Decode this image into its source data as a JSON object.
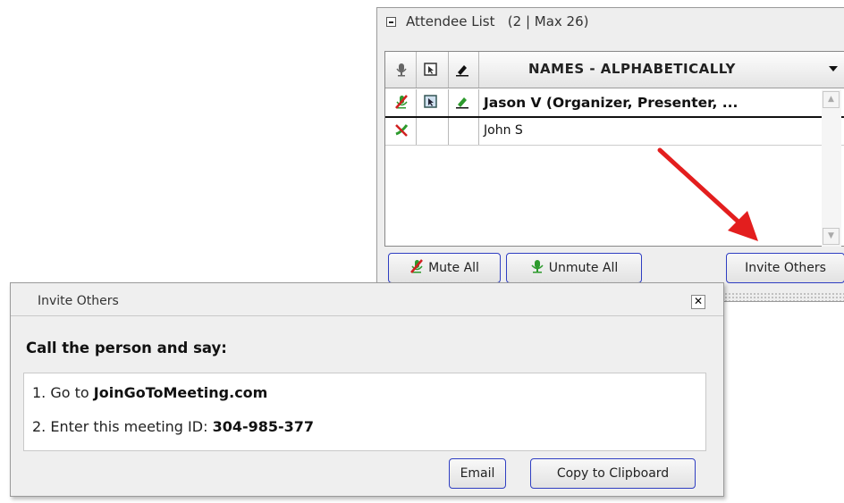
{
  "attendee_panel": {
    "title": "Attendee List",
    "count_label": "(2 | Max 26)",
    "column_header": "NAMES - ALPHABETICALLY",
    "rows": [
      {
        "name": "Jason V (Organizer, Presenter, ..."
      },
      {
        "name": "John S"
      }
    ],
    "buttons": {
      "mute_all": "Mute All",
      "unmute_all": "Unmute All",
      "invite_others": "Invite Others"
    }
  },
  "invite_dialog": {
    "title": "Invite Others",
    "heading": "Call the person and say:",
    "line1_prefix": "1. Go to ",
    "line1_value": "JoinGoToMeeting.com",
    "line2_prefix": "2. Enter this meeting ID: ",
    "line2_value": "304-985-377",
    "email_label": "Email",
    "clipboard_label": "Copy to Clipboard"
  },
  "icons": {
    "mic": "microphone-icon",
    "screen": "screen-icon",
    "pen": "pen-icon",
    "muted": "muted-microphone-icon",
    "close": "close-icon",
    "arrow": "red-pointer-arrow"
  },
  "colors": {
    "button_border": "#2f3ec2",
    "annotation_arrow": "#e31e1e",
    "muted_red": "#d02020",
    "active_green": "#2d9a2d"
  }
}
